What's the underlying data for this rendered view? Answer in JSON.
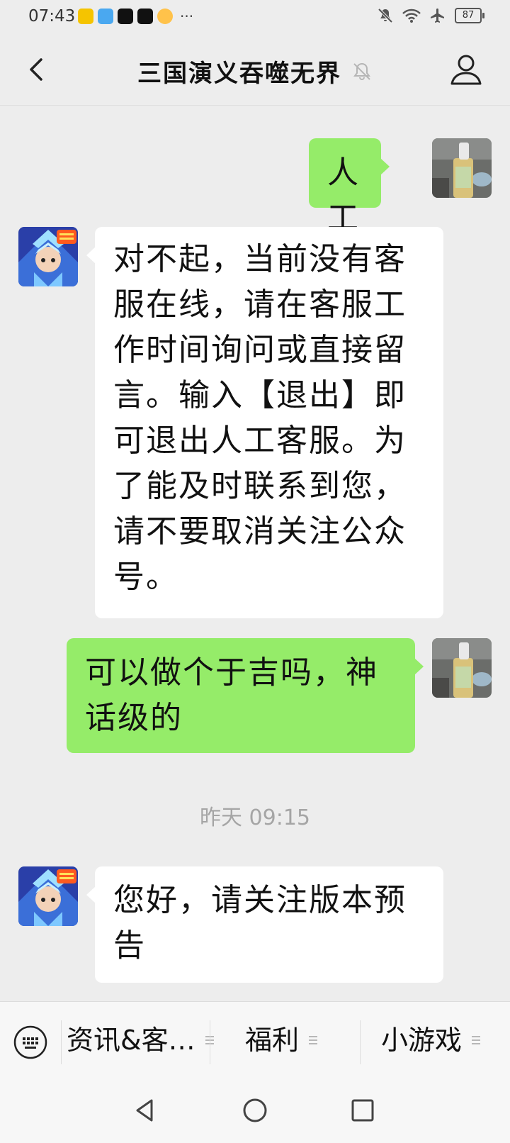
{
  "status_bar": {
    "time": "07:43",
    "notification_apps": [
      "weibo-icon",
      "reader-icon",
      "tiktok-icon",
      "tiktok-icon",
      "weather-icon"
    ],
    "more": "···",
    "battery": "87"
  },
  "nav": {
    "title": "三国演义吞噬无界"
  },
  "messages": [
    {
      "side": "right",
      "text": "人工"
    },
    {
      "side": "left",
      "text": "对不起，当前没有客服在线，请在客服工作时间询问或直接留言。输入【退出】即可退出人工客服。为了能及时联系到您，请不要取消关注公众号。"
    },
    {
      "side": "right",
      "text": "可以做个于吉吗，神话级的"
    },
    {
      "side": "left",
      "text": "您好，请关注版本预告"
    }
  ],
  "timestamp": "昨天 09:15",
  "bottom_menu": {
    "items": [
      "资讯&客…",
      "福利",
      "小游戏"
    ]
  },
  "colors": {
    "chat_bg": "#ededed",
    "sent_bubble": "#95ec69",
    "received_bubble": "#ffffff"
  }
}
